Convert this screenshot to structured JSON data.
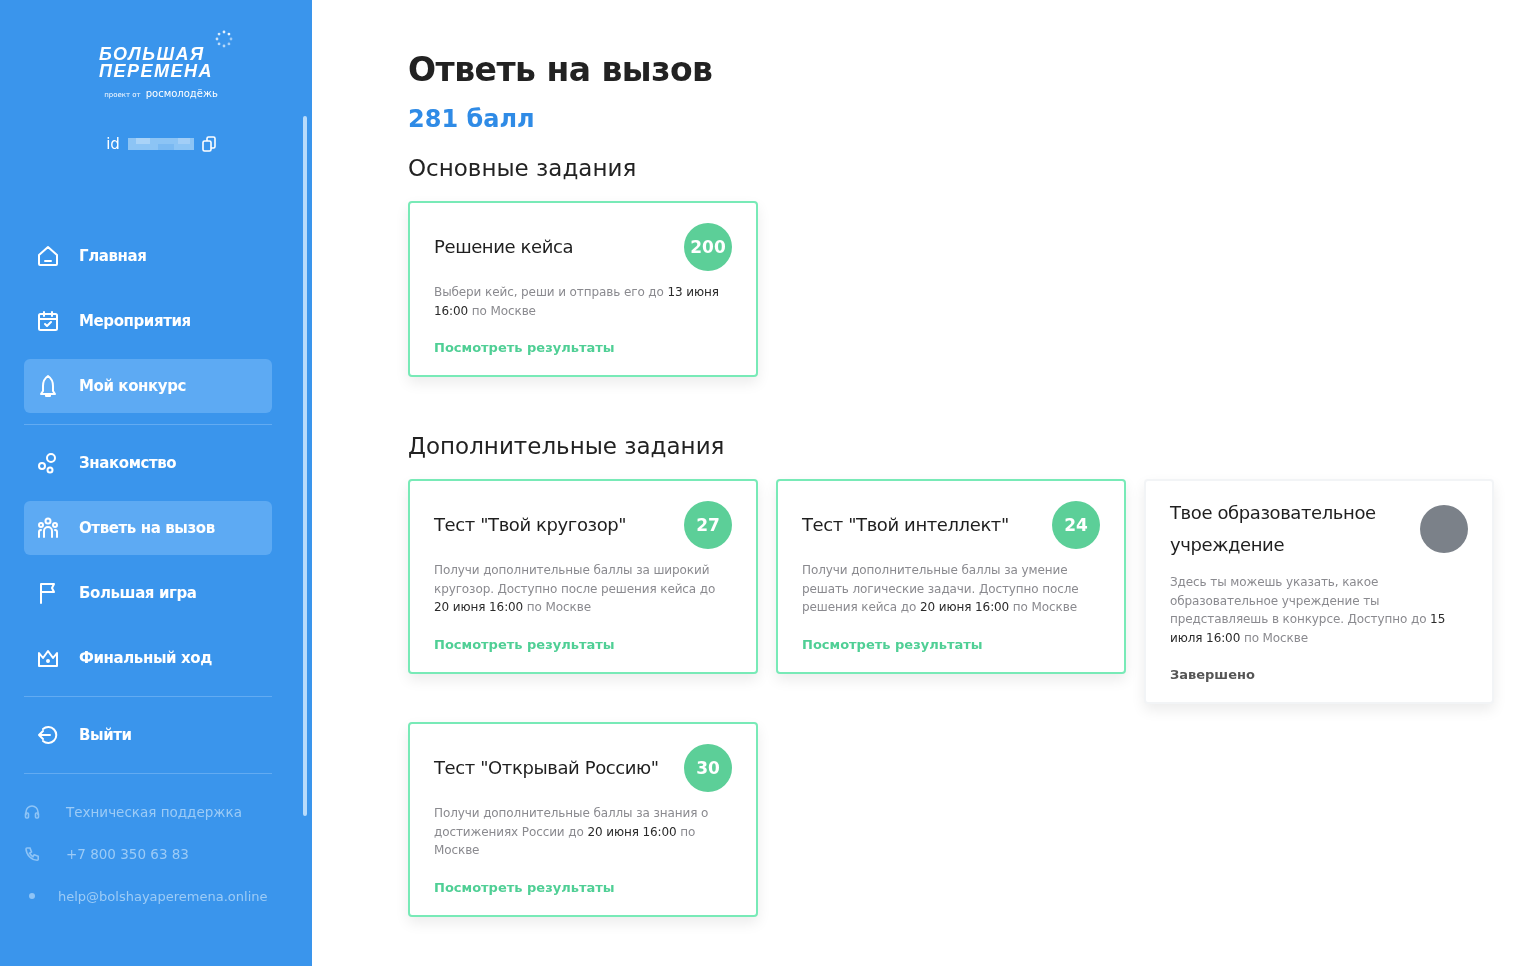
{
  "sidebar": {
    "logo": {
      "line_1": "БОЛЬШАЯ",
      "line_2": "ПЕРЕМЕНА",
      "tagline": "проект от",
      "brand": "росмолодёжь"
    },
    "user_id_label": "id",
    "nav_groups": [
      [
        {
          "label": "Главная",
          "selected": false
        },
        {
          "label": "Мероприятия",
          "selected": false
        },
        {
          "label": "Мой конкурс",
          "selected": true
        }
      ],
      [
        {
          "label": "Знакомство",
          "selected": false
        },
        {
          "label": "Ответь на вызов",
          "selected": true
        },
        {
          "label": "Большая игра",
          "selected": false
        },
        {
          "label": "Финальный ход",
          "selected": false
        }
      ],
      [
        {
          "label": "Выйти",
          "selected": false
        }
      ]
    ],
    "contacts": [
      {
        "text": "Техническая поддержка"
      },
      {
        "text": "+7 800 350 63 83"
      },
      {
        "text": "help@bolshayaperemena.online"
      }
    ]
  },
  "page": {
    "title": "Ответь на вызов",
    "score": "281 балл",
    "sections": [
      {
        "title": "Основные задания",
        "cards": [
          {
            "title": "Решение кейса",
            "points": "200",
            "color": "#5ccf98",
            "description": "Выбери кейс, реши и отправь его до **13 июня 16:00** по Москве",
            "completed": false,
            "footer": "Посмотреть результаты"
          }
        ]
      },
      {
        "title": "Дополнительные задания",
        "cards": [
          {
            "title": "Тест \"Твой кругозор\"",
            "points": "27",
            "color": "#5ccf98",
            "description": "Получи дополнительные баллы за широкий кругозор. Доступно после решения кейса до **20 июня 16:00** по Москве",
            "completed": false,
            "footer": "Посмотреть результаты"
          },
          {
            "title": "Тест \"Твой интеллект\"",
            "points": "24",
            "color": "#5ccf98",
            "description": "Получи дополнительные баллы за умение решать логические задачи. Доступно после решения кейса до **20 июня 16:00** по Москве",
            "completed": false,
            "footer": "Посмотреть результаты"
          },
          {
            "title": "Твое образовательное учреждение",
            "color": "#7b8189",
            "description": "Здесь ты можешь указать, какое образовательное учреждение ты представляешь в конкурсе. Доступно до **15 июля 16:00** по Москве",
            "completed": true,
            "footer": "Завершено"
          },
          {
            "title": "Тест \"Открывай Россию\"",
            "points": "30",
            "color": "#5ccf98",
            "description": "Получи дополнительные баллы за знания о достижениях России до **20 июня 16:00** по Москве",
            "completed": false,
            "footer": "Посмотреть результаты"
          }
        ]
      }
    ]
  }
}
